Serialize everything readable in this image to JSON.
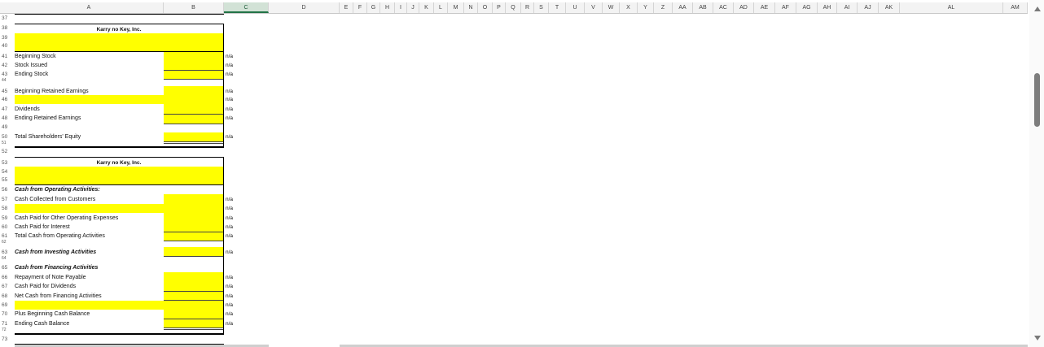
{
  "columns": [
    "A",
    "B",
    "C",
    "D",
    "E",
    "F",
    "G",
    "H",
    "I",
    "J",
    "K",
    "L",
    "M",
    "N",
    "O",
    "P",
    "Q",
    "R",
    "S",
    "T",
    "U",
    "V",
    "W",
    "X",
    "Y",
    "Z",
    "AA",
    "AB",
    "AC",
    "AD",
    "AE",
    "AF",
    "AG",
    "AH",
    "AI",
    "AJ",
    "AK",
    "AL",
    "AM"
  ],
  "selected_column": "C",
  "rows": {
    "r37": "37",
    "r38": "38",
    "r39": "39",
    "r40": "40",
    "r41": "41",
    "r42": "42",
    "r43": "43",
    "r44": "44",
    "r45": "45",
    "r46": "46",
    "r47": "47",
    "r48": "48",
    "r49": "49",
    "r50": "50",
    "r51": "51",
    "r52": "52",
    "r53": "53",
    "r54": "54",
    "r55": "55",
    "r56": "56",
    "r57": "57",
    "r58": "58",
    "r59": "59",
    "r60": "60",
    "r61": "61",
    "r62": "62",
    "r63": "63",
    "r64": "64",
    "r65": "65",
    "r66": "66",
    "r67": "67",
    "r68": "68",
    "r69": "69",
    "r70": "70",
    "r71": "71",
    "r72": "72",
    "r73": "73"
  },
  "equity": {
    "title": "Karry no Key, Inc.",
    "beginning_stock": "Beginning Stock",
    "stock_issued": "Stock Issued",
    "ending_stock": "Ending Stock",
    "beginning_re": "Beginning Retained Earnings",
    "dividends": "Dividends",
    "ending_re": "Ending Retained Earnings",
    "total_equity": "Total Shareholders' Equity"
  },
  "cashflow": {
    "title": "Karry no Key, Inc.",
    "operating_header": "Cash from Operating Activities:",
    "cash_collected": "Cash Collected from Customers",
    "cash_paid_other": "Cash Paid for Other Operating Expenses",
    "cash_paid_interest": "Cash Paid for Interest",
    "total_operating": "Total Cash from Operating Activities",
    "investing_header": "Cash from Investing Activities",
    "financing_header": "Cash from Financing Activities",
    "repayment_note": "Repayment of Note Payable",
    "cash_paid_dividends": "Cash Paid for Dividends",
    "net_financing": "Net Cash from Financing Activities",
    "plus_beginning": "Plus Beginning Cash Balance",
    "ending_cash": "Ending Cash Balance"
  },
  "na": "n/a",
  "colors": {
    "highlight": "#ffff00",
    "selected_header": "#d2e2d6",
    "excel_green": "#217346"
  }
}
